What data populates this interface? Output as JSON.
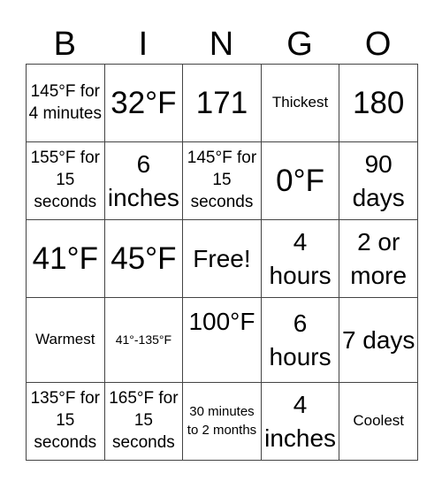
{
  "header": [
    "B",
    "I",
    "N",
    "G",
    "O"
  ],
  "rows": [
    [
      "145°F for 4 minutes",
      "32°F",
      "171",
      "Thickest",
      "180"
    ],
    [
      "155°F for 15 seconds",
      "6 inches",
      "145°F for 15 seconds",
      "0°F",
      "90 days"
    ],
    [
      "41°F",
      "45°F",
      "Free!",
      "4 hours",
      "2 or more"
    ],
    [
      "Warmest",
      "41°-135°F",
      "100°F",
      "6 hours",
      "7 days"
    ],
    [
      "135°F for 15 seconds",
      "165°F for 15 seconds",
      "30 minutes to 2 months",
      "4 inches",
      "Coolest"
    ]
  ]
}
